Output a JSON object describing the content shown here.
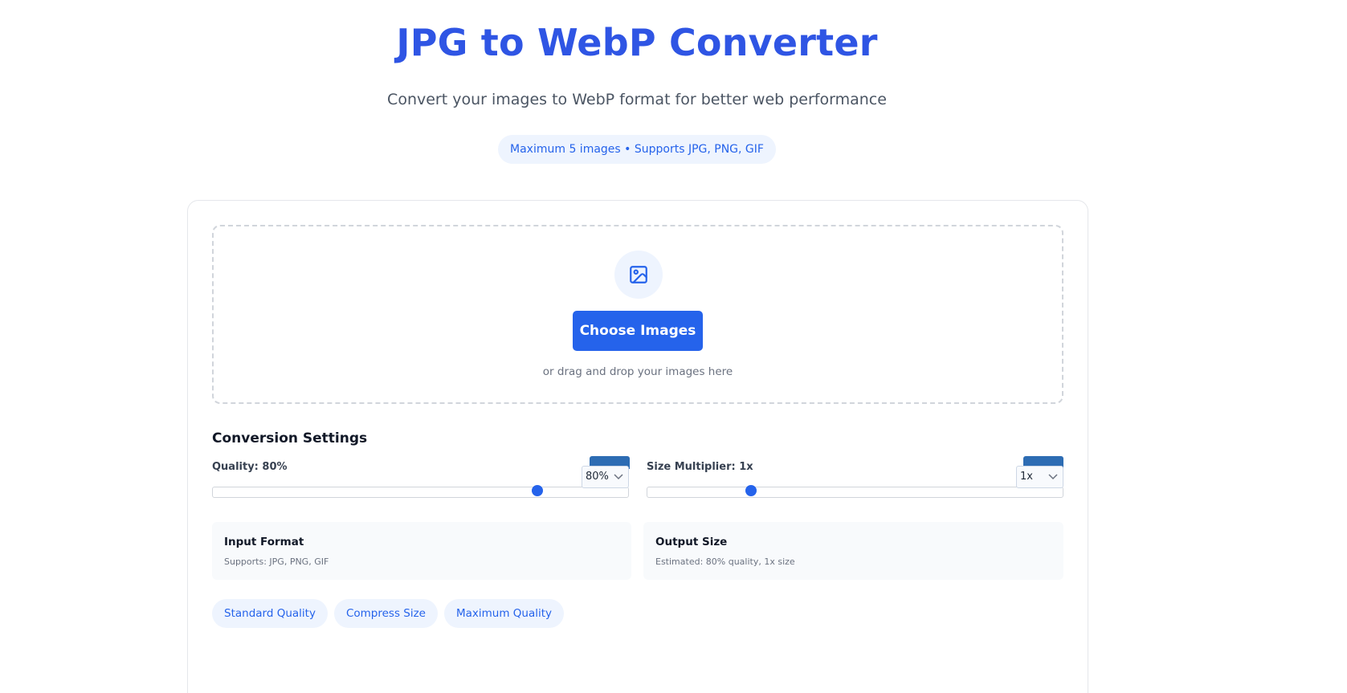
{
  "header": {
    "title": "JPG to WebP Converter",
    "subtitle": "Convert your images to WebP format for better web performance",
    "limits_badge": "Maximum 5 images • Supports JPG, PNG, GIF"
  },
  "upload": {
    "icon": "image-icon",
    "button_label": "Choose Images",
    "hint": "or drag and drop your images here"
  },
  "settings": {
    "title": "Conversion Settings",
    "quality": {
      "label": "Quality: 80%",
      "value_percent": 80,
      "slider_fraction": 0.78,
      "select_value": "80%"
    },
    "size_multiplier": {
      "label": "Size Multiplier: 1x",
      "value": "1x",
      "slider_fraction": 0.25,
      "select_value": "1x"
    }
  },
  "info": {
    "input": {
      "title": "Input Format",
      "desc": "Supports: JPG, PNG, GIF"
    },
    "output": {
      "title": "Output Size",
      "desc": "Estimated: 80% quality, 1x size"
    }
  },
  "presets": [
    "Standard Quality",
    "Compress Size",
    "Maximum Quality"
  ],
  "colors": {
    "accent": "#2563eb",
    "title": "#2f55e4",
    "pill_bg": "#eef4fe"
  }
}
